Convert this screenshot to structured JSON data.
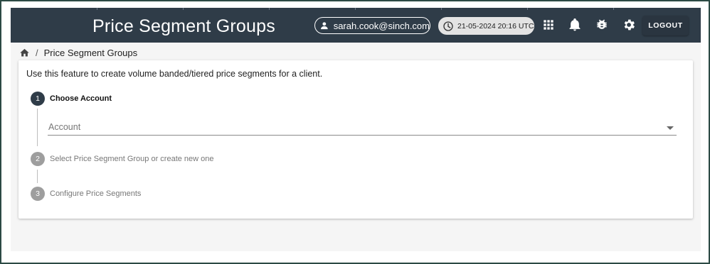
{
  "header": {
    "title": "Price Segment Groups",
    "user_email": "sarah.cook@sinch.com",
    "datetime": "21-05-2024 20:16 UTC",
    "logout_label": "LOGOUT",
    "icons": [
      "apps-grid-icon",
      "bell-icon",
      "bug-icon",
      "gear-icon"
    ],
    "bar_color": "#2f3c48"
  },
  "breadcrumb": {
    "home_icon": "home-icon",
    "separator": "/",
    "current": "Price Segment Groups"
  },
  "main": {
    "intro": "Use this feature to create volume banded/tiered price segments for a client.",
    "steps": [
      {
        "number": "1",
        "label": "Choose Account",
        "state": "active"
      },
      {
        "number": "2",
        "label": "Select Price Segment Group or create new one",
        "state": "inactive"
      },
      {
        "number": "3",
        "label": "Configure Price Segments",
        "state": "inactive"
      }
    ],
    "account_select": {
      "placeholder": "Account",
      "value": ""
    }
  }
}
